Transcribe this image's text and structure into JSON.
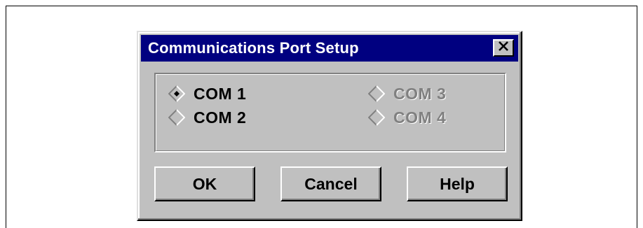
{
  "dialog": {
    "title": "Communications Port Setup",
    "close_icon": "close-x-icon"
  },
  "ports": [
    {
      "label": "COM 1",
      "selected": true,
      "enabled": true
    },
    {
      "label": "COM 2",
      "selected": false,
      "enabled": true
    },
    {
      "label": "COM 3",
      "selected": false,
      "enabled": false
    },
    {
      "label": "COM 4",
      "selected": false,
      "enabled": false
    }
  ],
  "buttons": {
    "ok": "OK",
    "cancel": "Cancel",
    "help": "Help"
  },
  "colors": {
    "title_bar": "#000080",
    "dialog_face": "#c0c0c0",
    "disabled_text": "#808080"
  }
}
